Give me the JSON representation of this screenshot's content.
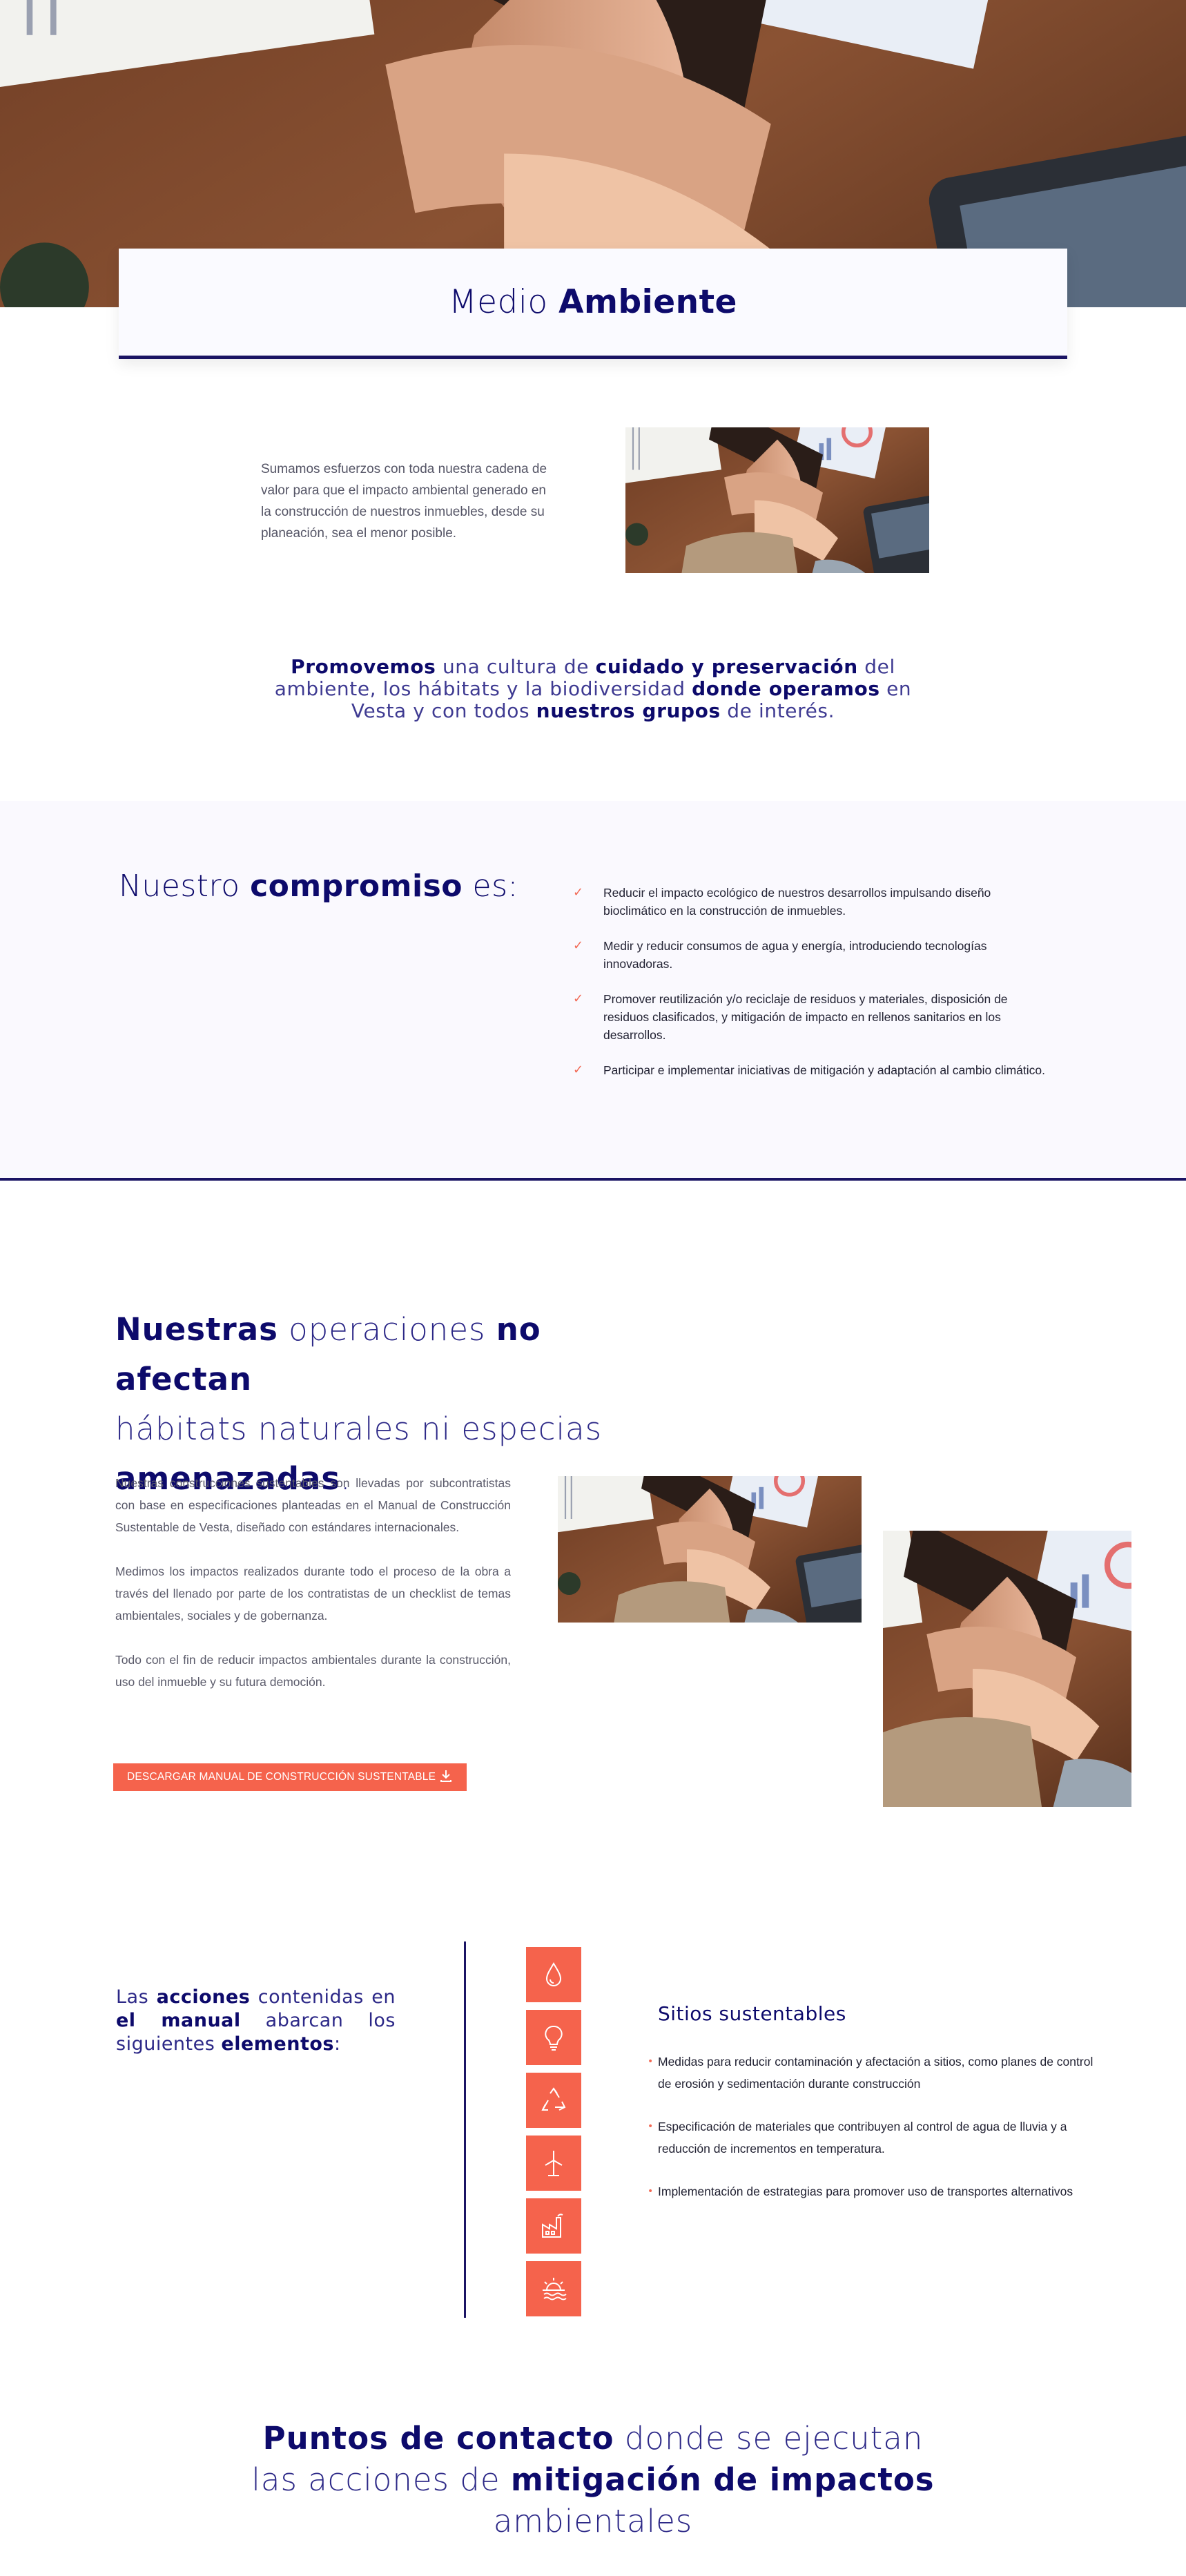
{
  "header": {
    "title_light": "Medio ",
    "title_bold": "Ambiente",
    "hero_image": "team-hands-stacked-photo"
  },
  "intro": {
    "text": "Sumamos esfuerzos con toda nuestra cadena de valor para que el impacto ambiental generado en la construcción de nuestros inmuebles, desde su planeación, sea el menor posible.",
    "image": "team-hands-stacked-photo"
  },
  "promo": {
    "segments": [
      {
        "text": "Promovemos",
        "bold": true
      },
      {
        "text": " una cultura de ",
        "bold": false
      },
      {
        "text": "cuidado y preservación",
        "bold": true
      },
      {
        "text": " del ambiente, los hábitats y la biodiversidad ",
        "bold": false
      },
      {
        "text": "donde operamos",
        "bold": true
      },
      {
        "text": " en Vesta y con todos ",
        "bold": false
      },
      {
        "text": "nuestros grupos",
        "bold": true
      },
      {
        "text": " de interés.",
        "bold": false
      }
    ]
  },
  "compromiso": {
    "title_pre": "Nuestro ",
    "title_bold": "compromiso",
    "title_post": " es:",
    "check_icon": "checkmark-icon",
    "items": [
      "Reducir el impacto ecológico de nuestros desarrollos impulsando diseño bioclimático en la construcción de inmuebles.",
      "Medir y reducir consumos de agua y energía, introduciendo tecnologías innovadoras.",
      "Promover reutilización y/o reciclaje de residuos y materiales, disposición de residuos clasificados, y mitigación de impacto en rellenos sanitarios en los desarrollos.",
      "Participar e implementar iniciativas de mitigación y adaptación al cambio climático."
    ]
  },
  "operaciones": {
    "title_segments": [
      {
        "text": "Nuestras",
        "bold": true
      },
      {
        "text": " operaciones ",
        "bold": false
      },
      {
        "text": "no afectan",
        "bold": true
      },
      {
        "text": " hábitats naturales ni especias ",
        "bold": false
      },
      {
        "text": "amenazadas",
        "bold": true
      },
      {
        "text": ".",
        "bold": false
      }
    ],
    "paragraphs": [
      "Nuestras construcciones sustentables son llevadas por subcontratistas con base en especificaciones planteadas en el Manual de Construcción Sustentable de Vesta, diseñado con estándares internacionales.",
      "Medimos los impactos realizados durante todo el proceso de la obra a través del llenado por parte de los contratistas de un checklist de temas ambientales, sociales y de gobernanza.",
      "Todo con el fin de reducir impactos ambientales durante la construcción, uso del inmueble y su futura democión."
    ],
    "download_label": "DESCARGAR MANUAL DE CONSTRUCCIÓN SUSTENTABLE",
    "download_icon": "download-icon"
  },
  "acciones": {
    "text_segments": [
      {
        "text": "Las ",
        "bold": false
      },
      {
        "text": "acciones",
        "bold": true
      },
      {
        "text": " contenidas en ",
        "bold": false
      },
      {
        "text": "el manual",
        "bold": true
      },
      {
        "text": " abarcan los siguientes ",
        "bold": false
      },
      {
        "text": "elementos",
        "bold": true
      },
      {
        "text": ":",
        "bold": false
      }
    ],
    "icons": [
      "water-drop-icon",
      "lightbulb-icon",
      "recycle-icon",
      "wind-turbine-icon",
      "factory-icon",
      "sunset-water-icon"
    ],
    "active_title": "Sitios sustentables",
    "bullets": [
      "Medidas para reducir contaminación y afectación a sitios, como planes de control de erosión y sedimentación durante construcción",
      "Especificación de materiales que contribuyen al control de agua de lluvia y a reducción de incrementos en temperatura.",
      "Implementación de estrategias para promover uso de transportes alternativos"
    ]
  },
  "puntos": {
    "segments": [
      {
        "text": "Puntos de contacto",
        "bold": true
      },
      {
        "text": " donde se ejecutan las acciones de ",
        "bold": false
      },
      {
        "text": "mitigación de impactos",
        "bold": true
      },
      {
        "text": " ambientales",
        "bold": false
      }
    ]
  },
  "colors": {
    "navy": "#0d0a6b",
    "accent": "#f5634c",
    "band_bg": "#faf9fe"
  }
}
